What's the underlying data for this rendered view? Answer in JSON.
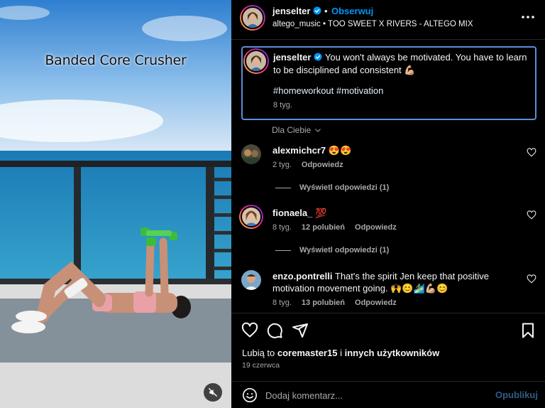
{
  "media": {
    "overlay_title": "Banded Core Crusher",
    "mute_icon": "speaker-muted-icon"
  },
  "header": {
    "username": "jenselter",
    "separator": "•",
    "follow_label": "Obserwuj",
    "audio_user": "altego_music",
    "audio_sep": "•",
    "audio_track": "TOO SWEET X RIVERS - ALTEGO MIX",
    "more_icon": "more-options-icon"
  },
  "caption": {
    "username": "jenselter",
    "text": "You won't always be motivated. You have to learn to be disciplined and consistent 💪🏼",
    "hashtags": "#homeworkout #motivation",
    "time": "8 tyg."
  },
  "for_you_label": "Dla Ciebie",
  "comments": [
    {
      "username": "alexmichcr7",
      "text": "😍😍",
      "time": "2 tyg.",
      "likes": "",
      "reply_label": "Odpowiedz",
      "view_replies": "Wyświetl odpowiedzi (1)"
    },
    {
      "username": "fionaela_",
      "text": "💯",
      "time": "8 tyg.",
      "likes": "12 polubień",
      "reply_label": "Odpowiedz",
      "view_replies": "Wyświetl odpowiedzi (1)"
    },
    {
      "username": "enzo.pontrelli",
      "text": "That's the spirit Jen keep that positive motivation movement going. 🙌😊🏄‍♂️💪🏼😊",
      "time": "8 tyg.",
      "likes": "13 polubień",
      "reply_label": "Odpowiedz"
    }
  ],
  "actions": {
    "likes_prefix": "Lubią to",
    "likes_user": "coremaster15",
    "likes_mid": "i",
    "likes_others": "innych użytkowników",
    "date": "19 czerwca"
  },
  "add_comment": {
    "placeholder": "Dodaj komentarz...",
    "publish_label": "Opublikuj"
  },
  "colors": {
    "accent_blue": "#0095f6",
    "background": "#000000",
    "muted_text": "#a8a8a8",
    "highlight_border": "#5b8ed6"
  }
}
